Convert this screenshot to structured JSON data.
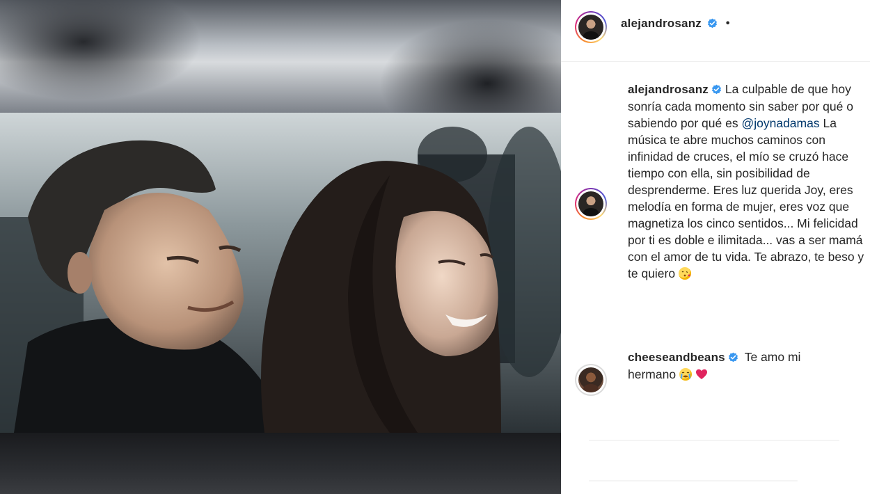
{
  "post": {
    "author": "alejandrosanz",
    "header_separator": "•",
    "caption": {
      "part1": "La culpable de que hoy sonría cada momento sin saber por qué o sabiendo por qué es ",
      "mention": "@joynadamas",
      "part2": " La música te abre muchos caminos con infinidad de cruces, el mío se cruzó hace tiempo con ella, sin posibilidad de desprenderme. Eres luz querida Joy, eres melodía en forma de mujer, eres voz que magnetiza los cinco sentidos... Mi felicidad por ti es doble e ilimitada... vas a ser mamá con el amor de tu vida. Te abrazo, te beso y te quiero",
      "emoji": "kissing-face-with-heart-emoji"
    }
  },
  "comments": [
    {
      "author": "cheeseandbeans",
      "text": "Te amo mi hermano",
      "emojis": [
        "crying-face-emoji",
        "red-heart-emoji"
      ]
    }
  ],
  "colors": {
    "verified": "#3897f0",
    "mention": "#00376b",
    "text": "#262626",
    "heart": "#e0245e"
  }
}
